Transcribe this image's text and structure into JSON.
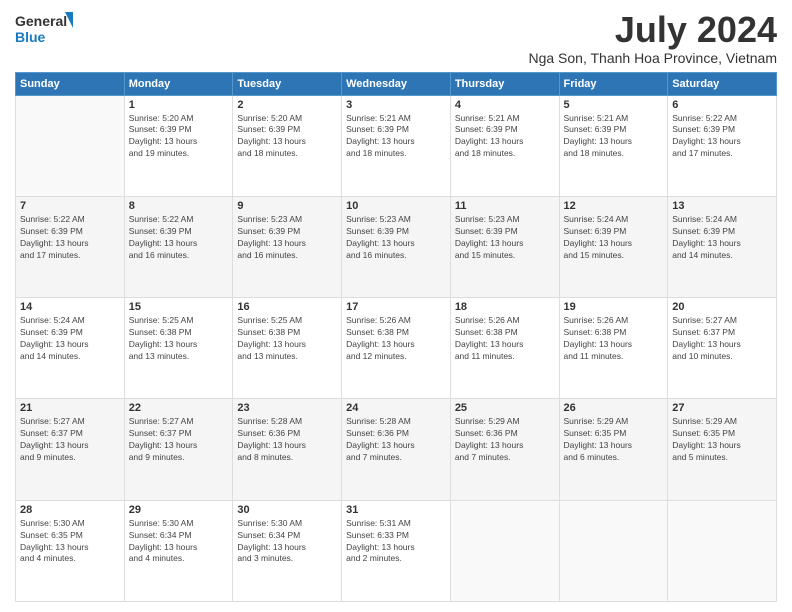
{
  "header": {
    "logo_line1": "General",
    "logo_line2": "Blue",
    "title": "July 2024",
    "subtitle": "Nga Son, Thanh Hoa Province, Vietnam"
  },
  "weekdays": [
    "Sunday",
    "Monday",
    "Tuesday",
    "Wednesday",
    "Thursday",
    "Friday",
    "Saturday"
  ],
  "weeks": [
    [
      {
        "day": "",
        "info": ""
      },
      {
        "day": "1",
        "info": "Sunrise: 5:20 AM\nSunset: 6:39 PM\nDaylight: 13 hours\nand 19 minutes."
      },
      {
        "day": "2",
        "info": "Sunrise: 5:20 AM\nSunset: 6:39 PM\nDaylight: 13 hours\nand 18 minutes."
      },
      {
        "day": "3",
        "info": "Sunrise: 5:21 AM\nSunset: 6:39 PM\nDaylight: 13 hours\nand 18 minutes."
      },
      {
        "day": "4",
        "info": "Sunrise: 5:21 AM\nSunset: 6:39 PM\nDaylight: 13 hours\nand 18 minutes."
      },
      {
        "day": "5",
        "info": "Sunrise: 5:21 AM\nSunset: 6:39 PM\nDaylight: 13 hours\nand 18 minutes."
      },
      {
        "day": "6",
        "info": "Sunrise: 5:22 AM\nSunset: 6:39 PM\nDaylight: 13 hours\nand 17 minutes."
      }
    ],
    [
      {
        "day": "7",
        "info": "Sunrise: 5:22 AM\nSunset: 6:39 PM\nDaylight: 13 hours\nand 17 minutes."
      },
      {
        "day": "8",
        "info": "Sunrise: 5:22 AM\nSunset: 6:39 PM\nDaylight: 13 hours\nand 16 minutes."
      },
      {
        "day": "9",
        "info": "Sunrise: 5:23 AM\nSunset: 6:39 PM\nDaylight: 13 hours\nand 16 minutes."
      },
      {
        "day": "10",
        "info": "Sunrise: 5:23 AM\nSunset: 6:39 PM\nDaylight: 13 hours\nand 16 minutes."
      },
      {
        "day": "11",
        "info": "Sunrise: 5:23 AM\nSunset: 6:39 PM\nDaylight: 13 hours\nand 15 minutes."
      },
      {
        "day": "12",
        "info": "Sunrise: 5:24 AM\nSunset: 6:39 PM\nDaylight: 13 hours\nand 15 minutes."
      },
      {
        "day": "13",
        "info": "Sunrise: 5:24 AM\nSunset: 6:39 PM\nDaylight: 13 hours\nand 14 minutes."
      }
    ],
    [
      {
        "day": "14",
        "info": "Sunrise: 5:24 AM\nSunset: 6:39 PM\nDaylight: 13 hours\nand 14 minutes."
      },
      {
        "day": "15",
        "info": "Sunrise: 5:25 AM\nSunset: 6:38 PM\nDaylight: 13 hours\nand 13 minutes."
      },
      {
        "day": "16",
        "info": "Sunrise: 5:25 AM\nSunset: 6:38 PM\nDaylight: 13 hours\nand 13 minutes."
      },
      {
        "day": "17",
        "info": "Sunrise: 5:26 AM\nSunset: 6:38 PM\nDaylight: 13 hours\nand 12 minutes."
      },
      {
        "day": "18",
        "info": "Sunrise: 5:26 AM\nSunset: 6:38 PM\nDaylight: 13 hours\nand 11 minutes."
      },
      {
        "day": "19",
        "info": "Sunrise: 5:26 AM\nSunset: 6:38 PM\nDaylight: 13 hours\nand 11 minutes."
      },
      {
        "day": "20",
        "info": "Sunrise: 5:27 AM\nSunset: 6:37 PM\nDaylight: 13 hours\nand 10 minutes."
      }
    ],
    [
      {
        "day": "21",
        "info": "Sunrise: 5:27 AM\nSunset: 6:37 PM\nDaylight: 13 hours\nand 9 minutes."
      },
      {
        "day": "22",
        "info": "Sunrise: 5:27 AM\nSunset: 6:37 PM\nDaylight: 13 hours\nand 9 minutes."
      },
      {
        "day": "23",
        "info": "Sunrise: 5:28 AM\nSunset: 6:36 PM\nDaylight: 13 hours\nand 8 minutes."
      },
      {
        "day": "24",
        "info": "Sunrise: 5:28 AM\nSunset: 6:36 PM\nDaylight: 13 hours\nand 7 minutes."
      },
      {
        "day": "25",
        "info": "Sunrise: 5:29 AM\nSunset: 6:36 PM\nDaylight: 13 hours\nand 7 minutes."
      },
      {
        "day": "26",
        "info": "Sunrise: 5:29 AM\nSunset: 6:35 PM\nDaylight: 13 hours\nand 6 minutes."
      },
      {
        "day": "27",
        "info": "Sunrise: 5:29 AM\nSunset: 6:35 PM\nDaylight: 13 hours\nand 5 minutes."
      }
    ],
    [
      {
        "day": "28",
        "info": "Sunrise: 5:30 AM\nSunset: 6:35 PM\nDaylight: 13 hours\nand 4 minutes."
      },
      {
        "day": "29",
        "info": "Sunrise: 5:30 AM\nSunset: 6:34 PM\nDaylight: 13 hours\nand 4 minutes."
      },
      {
        "day": "30",
        "info": "Sunrise: 5:30 AM\nSunset: 6:34 PM\nDaylight: 13 hours\nand 3 minutes."
      },
      {
        "day": "31",
        "info": "Sunrise: 5:31 AM\nSunset: 6:33 PM\nDaylight: 13 hours\nand 2 minutes."
      },
      {
        "day": "",
        "info": ""
      },
      {
        "day": "",
        "info": ""
      },
      {
        "day": "",
        "info": ""
      }
    ]
  ]
}
